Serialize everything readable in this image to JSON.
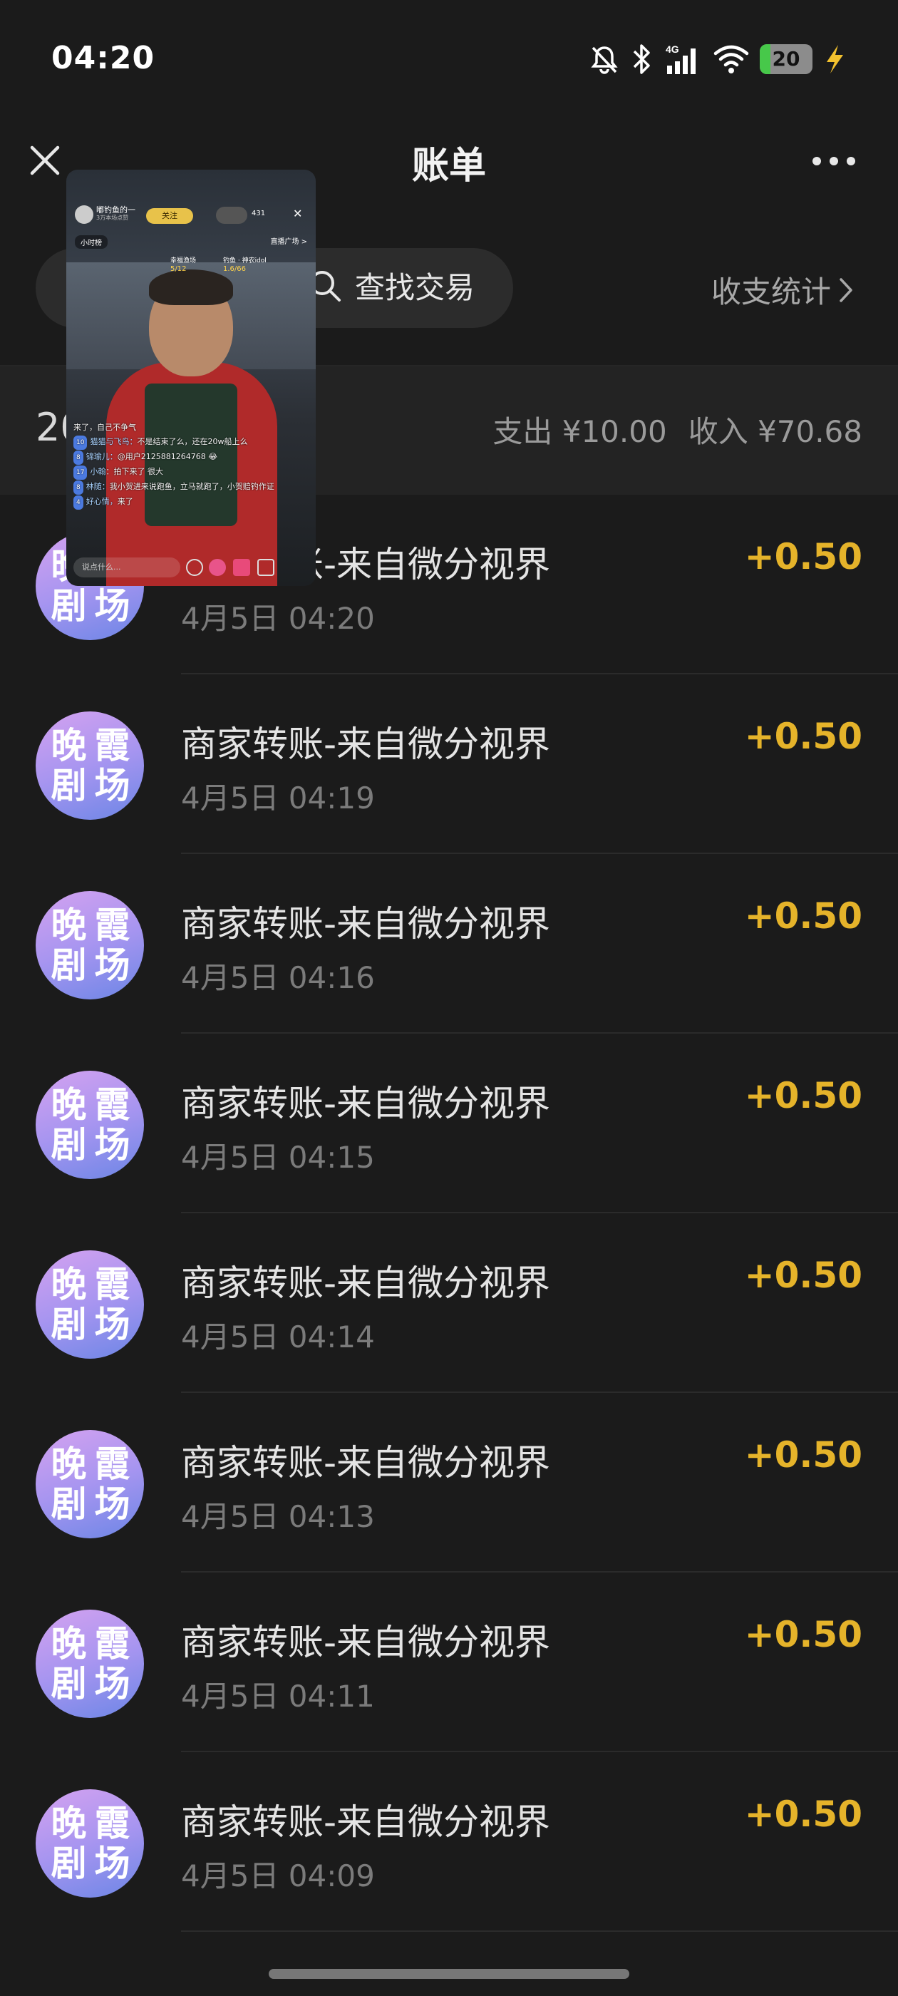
{
  "status_bar": {
    "time": "04:20",
    "network": "4G",
    "battery": "20",
    "battery_level_percent": 20,
    "icons": [
      "bell-muted-icon",
      "bluetooth-icon",
      "signal-4g-icon",
      "wifi-icon",
      "battery-icon",
      "charging-bolt-icon"
    ]
  },
  "header": {
    "title": "账单",
    "close_icon": "close-icon",
    "more_icon": "more-dots-icon"
  },
  "filter": {
    "search_label": "查找交易",
    "stats_label": "收支统计"
  },
  "summary": {
    "month_fragment": "20",
    "expense": "支出 ¥10.00",
    "income": "收入 ¥70.68"
  },
  "avatar_chars": [
    "晚",
    "霞",
    "剧",
    "场"
  ],
  "transactions": [
    {
      "title": "商家转账-来自微分视界",
      "time": "4月5日 04:20",
      "amount": "+0.50"
    },
    {
      "title": "商家转账-来自微分视界",
      "time": "4月5日 04:19",
      "amount": "+0.50"
    },
    {
      "title": "商家转账-来自微分视界",
      "time": "4月5日 04:16",
      "amount": "+0.50"
    },
    {
      "title": "商家转账-来自微分视界",
      "time": "4月5日 04:15",
      "amount": "+0.50"
    },
    {
      "title": "商家转账-来自微分视界",
      "time": "4月5日 04:14",
      "amount": "+0.50"
    },
    {
      "title": "商家转账-来自微分视界",
      "time": "4月5日 04:13",
      "amount": "+0.50"
    },
    {
      "title": "商家转账-来自微分视界",
      "time": "4月5日 04:11",
      "amount": "+0.50"
    },
    {
      "title": "商家转账-来自微分视界",
      "time": "4月5日 04:09",
      "amount": "+0.50"
    }
  ],
  "pip": {
    "host_name": "嘟钓鱼的一",
    "host_sub": "3万本场点赞",
    "follow": "关注",
    "viewer_count": "431",
    "tag_left": "小时榜",
    "tag_right": "直播广场 >",
    "stat1_label": "幸福渔场",
    "stat1_value": "5/12",
    "stat2_label": "钓鱼 · 神农idol",
    "stat2_value": "1.6/66",
    "chat": [
      {
        "lvl": "",
        "name": "",
        "text": "来了，自己不争气"
      },
      {
        "lvl": "10",
        "name": "猫猫与飞鸟：",
        "text": "不是结束了么，还在20w船上么"
      },
      {
        "lvl": "8",
        "name": "锦瑜儿：",
        "text": "@用户2125881264768 😂"
      },
      {
        "lvl": "17",
        "name": "小翰",
        "text": "：拍下来了 很大"
      },
      {
        "lvl": "8",
        "name": "林随：",
        "text": "我小贺进来说跑鱼，立马就跑了，小贺赔钓作证"
      },
      {
        "lvl": "4",
        "name": "好心情，",
        "text": "来了"
      }
    ],
    "input_placeholder": "说点什么..."
  }
}
